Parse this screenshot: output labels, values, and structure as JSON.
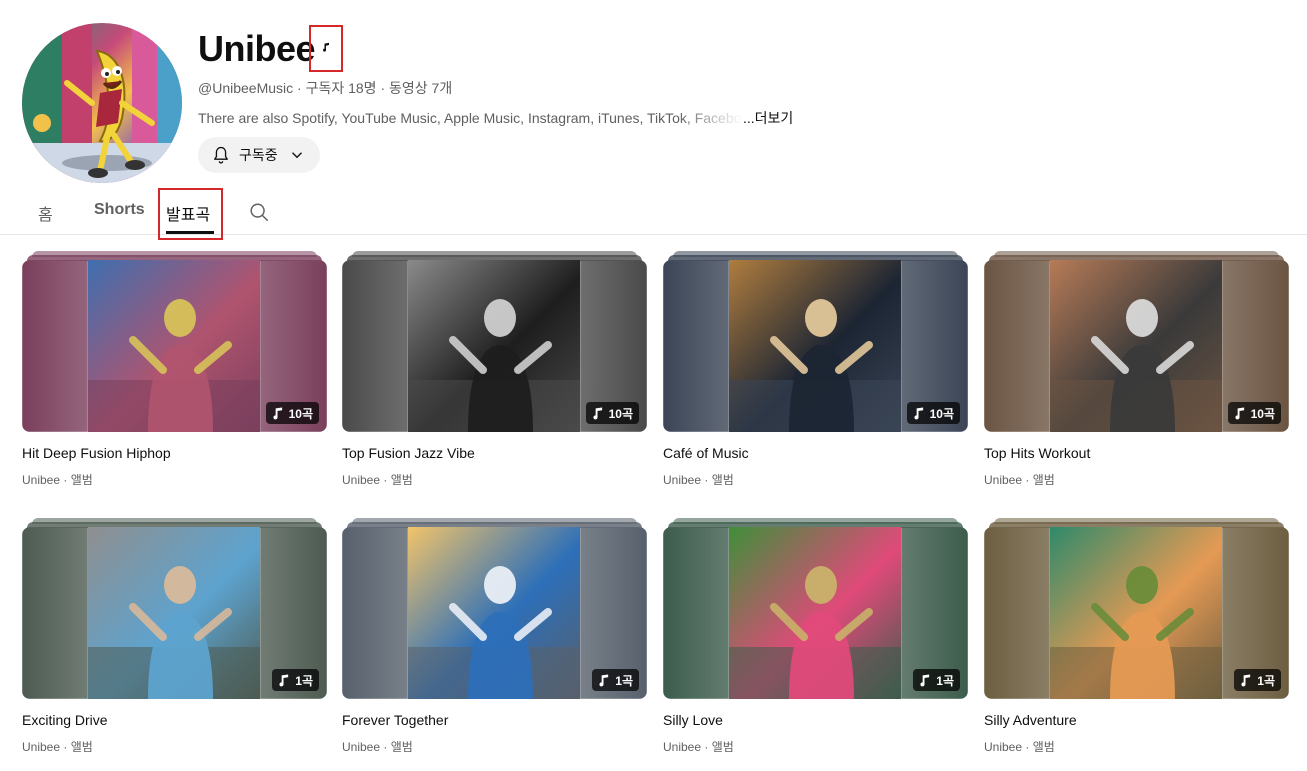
{
  "channel": {
    "name": "Unibee",
    "handle": "@UnibeeMusic",
    "meta_rest": " · 구독자 18명 · 동영상 7개",
    "description": "There are also Spotify, YouTube Music, Apple Music, Instagram, iTunes, TikTok, Facebook",
    "more_label": "...더보기",
    "subscribe_label": "구독중"
  },
  "tabs": [
    {
      "label": "홈",
      "active": false
    },
    {
      "label": "Shorts",
      "active": false
    },
    {
      "label": "발표곡",
      "active": true
    }
  ],
  "albums": [
    {
      "title": "Hit Deep Fusion Hiphop",
      "subtitle": "Unibee · 앨범",
      "count": "10곡",
      "colors": [
        "#7a3f5c",
        "#b0546f",
        "#3e6fb0",
        "#d7c25a"
      ]
    },
    {
      "title": "Top Fusion Jazz Vibe",
      "subtitle": "Unibee · 앨범",
      "count": "10곡",
      "colors": [
        "#4a4a4a",
        "#1e1e1e",
        "#8a8a8a",
        "#cfcfcf"
      ]
    },
    {
      "title": "Café of Music",
      "subtitle": "Unibee · 앨범",
      "count": "10곡",
      "colors": [
        "#3b4556",
        "#1c2533",
        "#b07d3f",
        "#e2c79a"
      ]
    },
    {
      "title": "Top Hits Workout",
      "subtitle": "Unibee · 앨범",
      "count": "10곡",
      "colors": [
        "#6b5442",
        "#3a3a3a",
        "#b77b57",
        "#d9d9d9"
      ]
    },
    {
      "title": "Exciting Drive",
      "subtitle": "Unibee · 앨범",
      "count": "1곡",
      "colors": [
        "#4d5b52",
        "#5da3cf",
        "#8f8f8f",
        "#d8b99b"
      ]
    },
    {
      "title": "Forever Together",
      "subtitle": "Unibee · 앨범",
      "count": "1곡",
      "colors": [
        "#57606c",
        "#2d6fb8",
        "#f2c46a",
        "#e9eef5"
      ]
    },
    {
      "title": "Silly Love",
      "subtitle": "Unibee · 앨범",
      "count": "1곡",
      "colors": [
        "#3d5c4c",
        "#e04a7a",
        "#3f8f3a",
        "#c9b26a"
      ]
    },
    {
      "title": "Silly Adventure",
      "subtitle": "Unibee · 앨범",
      "count": "1곡",
      "colors": [
        "#6d5e40",
        "#e59a54",
        "#2e8a6a",
        "#6a8c3a"
      ]
    }
  ],
  "icons": {
    "music_badge": "music-note-icon",
    "subscribe": "bell-icon",
    "dropdown": "chevron-down-icon",
    "search": "search-icon",
    "count": "music-note-icon"
  },
  "accent": {
    "highlight_box": "#d62828",
    "text_primary": "#0f0f0f",
    "text_secondary": "#606060"
  }
}
